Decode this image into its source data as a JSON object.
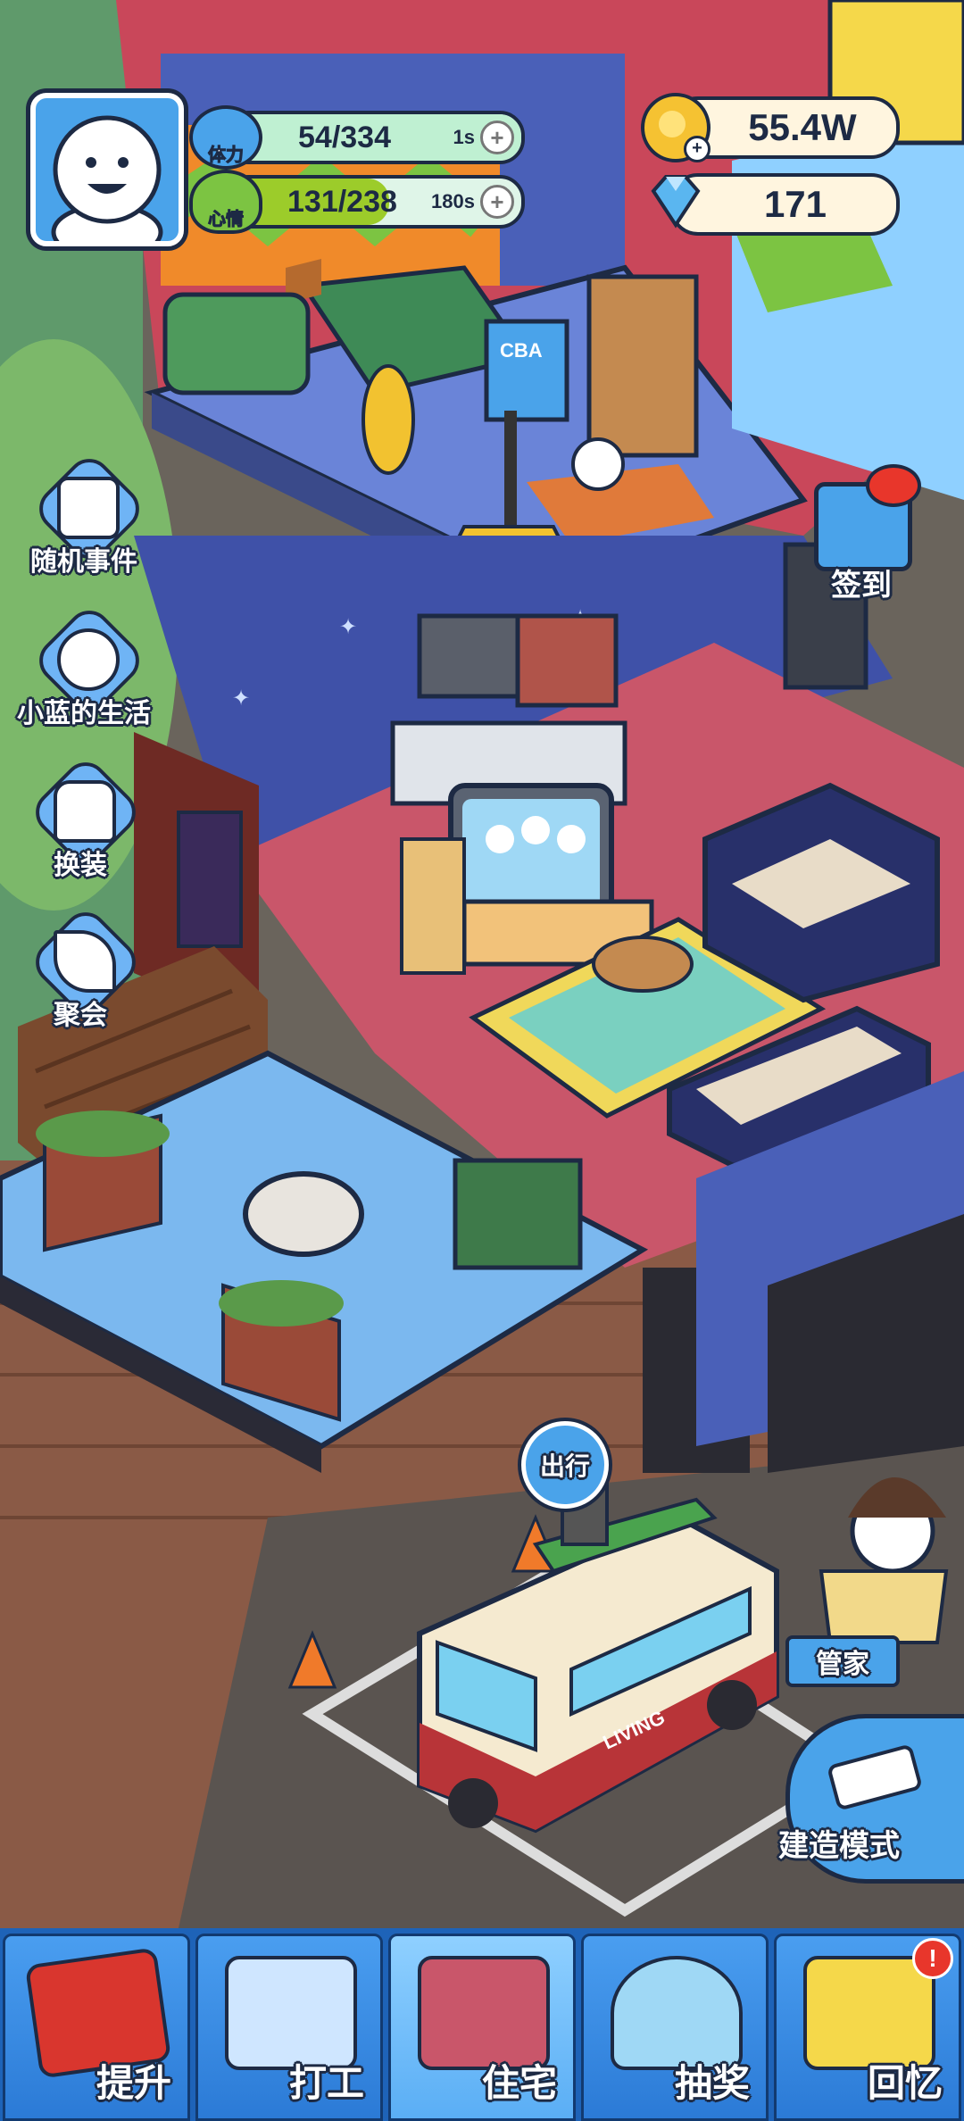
{
  "hud": {
    "stamina": {
      "label": "体力",
      "value": "54/334",
      "timer": "1s",
      "fill": 0.16
    },
    "mood": {
      "label": "心情",
      "value": "131/238",
      "timer": "180s",
      "fill": 0.55
    },
    "coins": "55.4W",
    "gems": "171"
  },
  "side_menu": [
    {
      "label": "随机事件",
      "icon": "scroll-hand-icon"
    },
    {
      "label": "小蓝的生活",
      "icon": "calendar-smile-icon"
    },
    {
      "label": "换装",
      "icon": "shirt-icon"
    },
    {
      "label": "聚会",
      "icon": "party-popper-icon"
    }
  ],
  "scene": {
    "sign_in_label": "签到",
    "go_out_label": "出行",
    "butler_label": "管家",
    "build_mode_label": "建造模式",
    "hoop_brand": "CBA",
    "van_text": "LIVING"
  },
  "bottom_nav": [
    {
      "label": "提升",
      "icon": "book-icon"
    },
    {
      "label": "打工",
      "icon": "id-badge-icon"
    },
    {
      "label": "住宅",
      "icon": "house-icon",
      "active": true
    },
    {
      "label": "抽奖",
      "icon": "gacha-machine-icon"
    },
    {
      "label": "回忆",
      "icon": "camera-icon",
      "badge": "!"
    }
  ],
  "colors": {
    "nav_blue": "#2b7ad6",
    "stamina_green": "#8ee6b8",
    "mood_green": "#9ccc2a",
    "coin_gold": "#f5c232",
    "gem_blue": "#5ab6f0"
  }
}
